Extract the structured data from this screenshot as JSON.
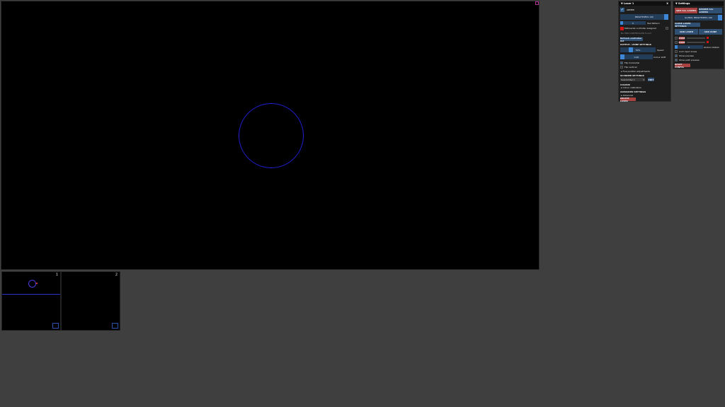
{
  "canvas": {
    "accent_color": "#1f1fd0"
  },
  "thumbnails": [
    {
      "label": "1"
    },
    {
      "label": "2"
    }
  ],
  "laser_panel": {
    "title": "Laser 1",
    "close": "X",
    "armed_label": "ARMED",
    "brightness_label": "BRIGHTNESS 100",
    "test_value": "0",
    "test_pattern_label": "Test Pattern",
    "midi_label": "Midi/serial controller assigned",
    "midi_hint": "No MIDI CONTROLLER found",
    "refresh_label": "Refresh controller list",
    "output_section": "OUTPUT / ZONE SETTINGS",
    "speed_value": "30%",
    "speed_label": "Speed",
    "colour_value": "0.00",
    "colour_label": "Colour shift",
    "flip_h": "Flip horizontal",
    "flip_v": "Flip vertical",
    "fine_adjust": "Fine position adjustments",
    "scanner_section": "SCANNER SETTINGS",
    "scanner_value": "Scanlimiter 1",
    "edit_label": "EDIT",
    "colour_section": "COLOUR",
    "colour_calibration": "Colour calibration",
    "advanced_section": "ADVANCED SETTINGS",
    "advanced_label": "Advanced",
    "delete_label": "DELETE LASER"
  },
  "settings_panel": {
    "title": "Settings",
    "arm_all": "ARM ALL LASERS",
    "disarm_all": "DISARM ALL LASERS",
    "global_brightness": "GLOBAL BRIGHTNESS 100",
    "close_settings": "CLOSE LASER SETTINGS",
    "add_laser": "ADD LASER",
    "add_zone": "ADD ZONE",
    "zone_a": "ZONE",
    "zone_b": "ZONE",
    "zero_value": "0",
    "global_rotation": "Global rotation",
    "lock_inputs": "Lock input zones",
    "show_preview": "Show preview",
    "show_path": "Show path preview",
    "reset_label": "RESET CONFIG"
  }
}
